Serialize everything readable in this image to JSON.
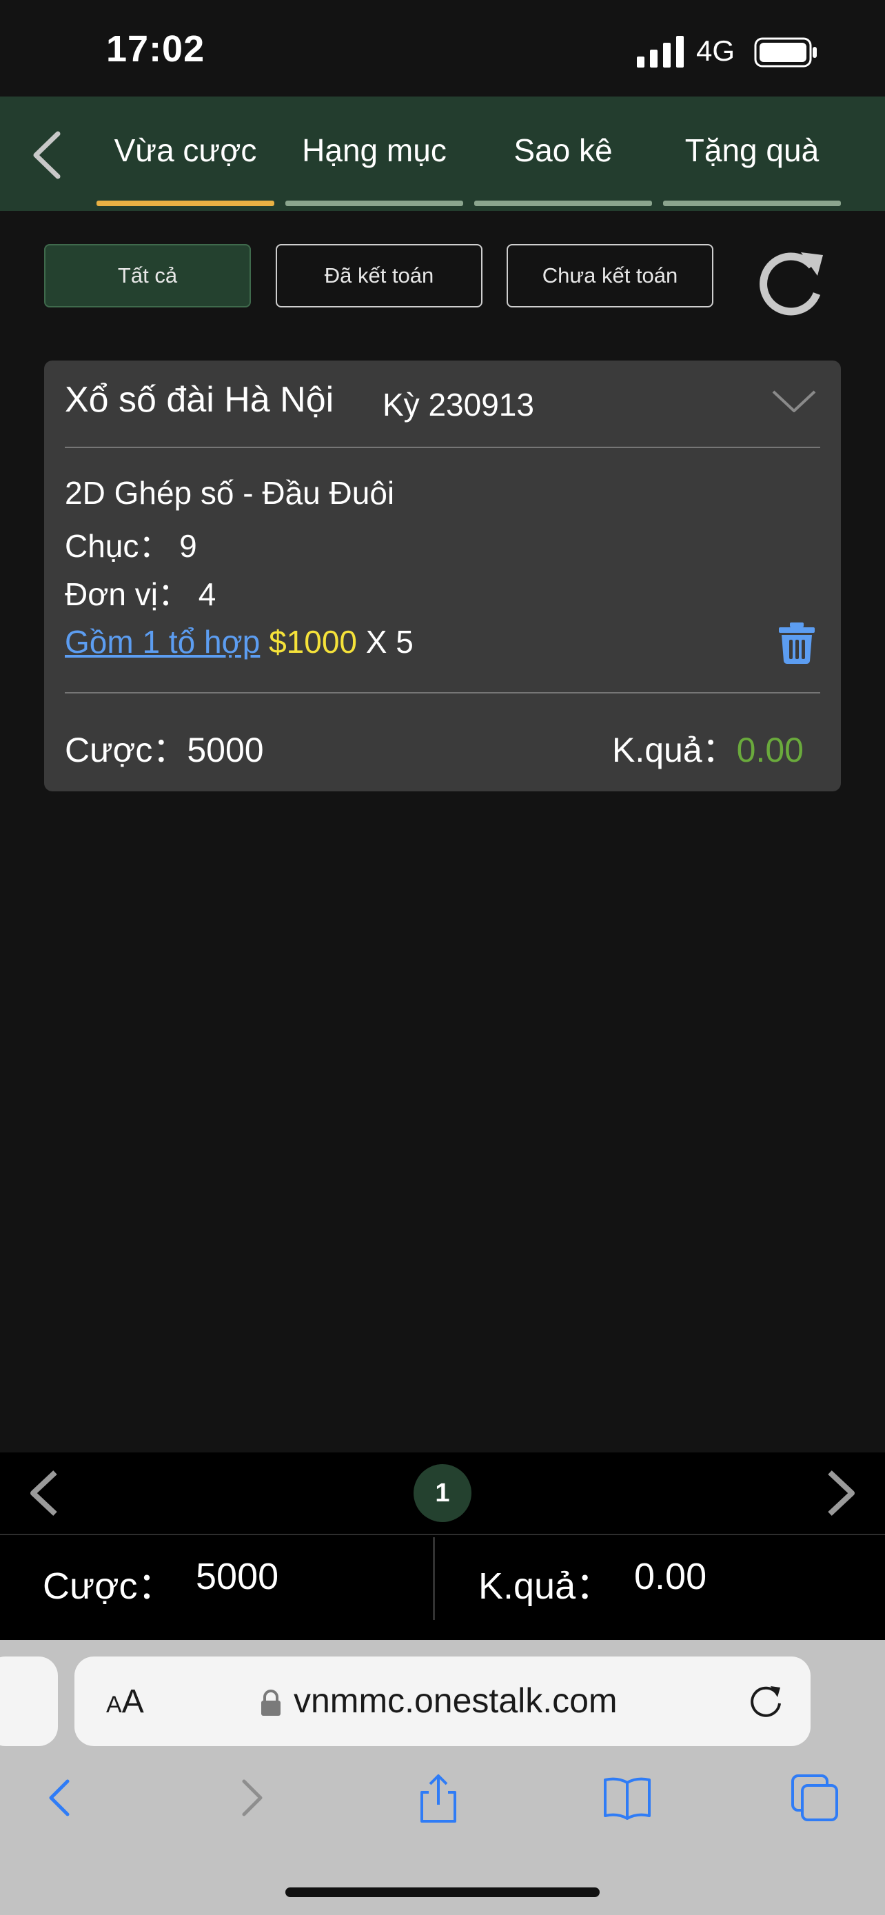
{
  "status": {
    "time": "17:02",
    "network": "4G"
  },
  "tabs": [
    {
      "label": "Vừa cược",
      "active": true
    },
    {
      "label": "Hạng mục",
      "active": false
    },
    {
      "label": "Sao kê",
      "active": false
    },
    {
      "label": "Tặng quà",
      "active": false
    }
  ],
  "filters": [
    {
      "label": "Tất cả",
      "active": true
    },
    {
      "label": "Đã kết toán",
      "active": false
    },
    {
      "label": "Chưa kết toán",
      "active": false
    }
  ],
  "bet": {
    "title": "Xổ số đài Hà Nội",
    "period": "Kỳ 230913",
    "type": "2D Ghép số - Đầu Đuôi",
    "tens_label": "Chục：",
    "tens_value": "9",
    "units_label": "Đơn vị：",
    "units_value": "4",
    "combo_link": "Gồm 1 tổ hợp",
    "unit_price": "$1000",
    "multiplier": "X 5",
    "stake_label": "Cược：",
    "stake_value": "5000",
    "result_label": "K.quả：",
    "result_value": "0.00"
  },
  "pager": {
    "current_page": "1"
  },
  "summary": {
    "stake_label": "Cược：",
    "stake_value": "5000",
    "result_label": "K.quả：",
    "result_value": "0.00"
  },
  "browser": {
    "aa_label": "AA",
    "url": "vnmmc.onestalk.com"
  },
  "colors": {
    "header_green": "#233d2e",
    "active_tab_underline": "#e9b144",
    "link_blue": "#5c9df1",
    "price_yellow": "#f5e23a",
    "result_green": "#6aaa3c"
  }
}
